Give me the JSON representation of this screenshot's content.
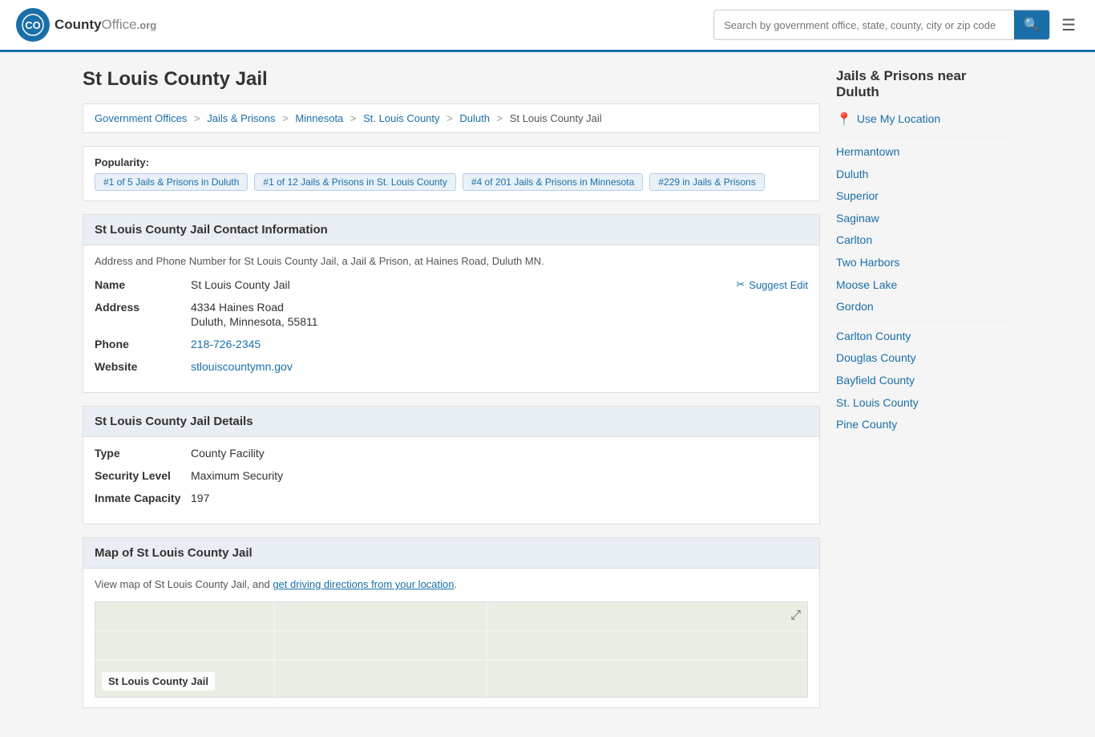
{
  "header": {
    "logo_text": "County",
    "logo_org": "Office",
    "logo_domain": ".org",
    "search_placeholder": "Search by government office, state, county, city or zip code",
    "search_btn_icon": "🔍"
  },
  "page": {
    "title": "St Louis County Jail"
  },
  "breadcrumb": {
    "items": [
      "Government Offices",
      "Jails & Prisons",
      "Minnesota",
      "St. Louis County",
      "Duluth",
      "St Louis County Jail"
    ]
  },
  "popularity": {
    "label": "Popularity:",
    "badges": [
      "#1 of 5 Jails & Prisons in Duluth",
      "#1 of 12 Jails & Prisons in St. Louis County",
      "#4 of 201 Jails & Prisons in Minnesota",
      "#229 in Jails & Prisons"
    ]
  },
  "contact": {
    "section_title": "St Louis County Jail Contact Information",
    "description": "Address and Phone Number for St Louis County Jail, a Jail & Prison, at Haines Road, Duluth MN.",
    "name_label": "Name",
    "name_value": "St Louis County Jail",
    "address_label": "Address",
    "address_line1": "4334 Haines Road",
    "address_line2": "Duluth, Minnesota, 55811",
    "phone_label": "Phone",
    "phone_value": "218-726-2345",
    "website_label": "Website",
    "website_value": "stlouiscountymn.gov",
    "suggest_edit": "Suggest Edit"
  },
  "details": {
    "section_title": "St Louis County Jail Details",
    "type_label": "Type",
    "type_value": "County Facility",
    "security_label": "Security Level",
    "security_value": "Maximum Security",
    "capacity_label": "Inmate Capacity",
    "capacity_value": "197"
  },
  "map": {
    "section_title": "Map of St Louis County Jail",
    "description_prefix": "View map of St Louis County Jail, and ",
    "description_link": "get driving directions from your location",
    "description_suffix": ".",
    "map_label": "St Louis County Jail"
  },
  "sidebar": {
    "title": "Jails & Prisons near Duluth",
    "use_location": "Use My Location",
    "links": [
      "Hermantown",
      "Duluth",
      "Superior",
      "Saginaw",
      "Carlton",
      "Two Harbors",
      "Moose Lake",
      "Gordon",
      "Carlton County",
      "Douglas County",
      "Bayfield County",
      "St. Louis County",
      "Pine County"
    ]
  }
}
